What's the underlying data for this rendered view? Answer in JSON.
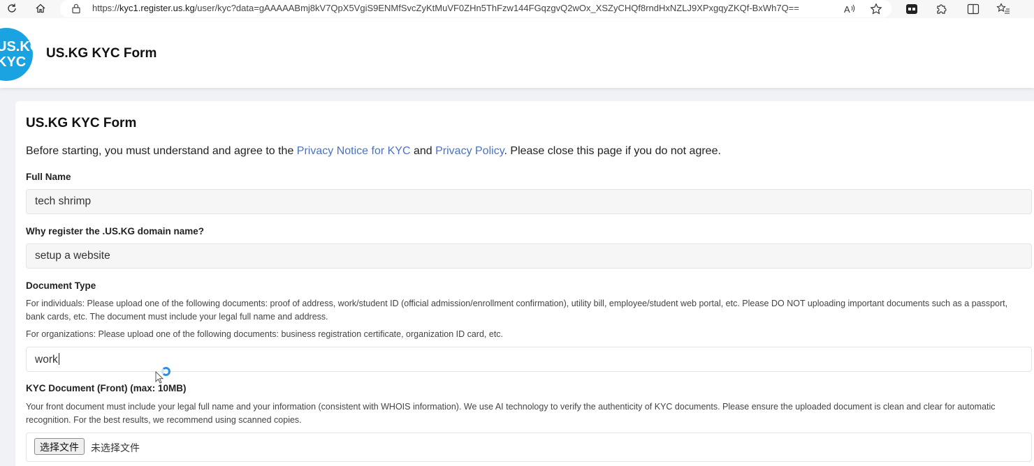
{
  "browser": {
    "url_scheme_prefix": "https://",
    "url_host": "kyc1.register.us.kg",
    "url_path": "/user/kyc?data=gAAAAABmj8kV7QpX5VgiS9ENMfSvcZyKtMuVF0ZHn5ThFzw144FGqzgvQ2wOx_XSZyCHQf8rndHxNZLJ9XPxgqyZKQf-BxWh7Q=="
  },
  "header": {
    "logo_line1": "US.KG",
    "logo_line2": "KYC",
    "title": "US.KG KYC Form"
  },
  "form": {
    "title": "US.KG KYC Form",
    "intro_before": "Before starting, you must understand and agree to the ",
    "link_kyc_notice": "Privacy Notice for KYC",
    "intro_and": " and ",
    "link_privacy_policy": "Privacy Policy",
    "intro_after": ". Please close this page if you do not agree.",
    "full_name_label": "Full Name",
    "full_name_value": "tech shrimp",
    "reason_label": "Why register the .US.KG domain name?",
    "reason_value": "setup a website",
    "doc_type_label": "Document Type",
    "doc_type_help_individuals": "For individuals: Please upload one of the following documents: proof of address, work/student ID (official admission/enrollment confirmation), utility bill, employee/student web portal, etc. Please DO NOT uploading important documents such as a passport, bank cards, etc. The document must include your legal full name and address.",
    "doc_type_help_orgs": "For organizations: Please upload one of the following documents: business registration certificate, organization ID card, etc.",
    "doc_type_value": "work",
    "kyc_front_label": "KYC Document (Front) (max: 10MB)",
    "kyc_front_help": "Your front document must include your legal full name and your information (consistent with WHOIS information). We use AI technology to verify the authenticity of KYC documents. Please ensure the uploaded document is clean and clear for automatic recognition. For the best results, we recommend using scanned copies.",
    "file_button_label": "选择文件",
    "file_status": "未选择文件"
  },
  "colors": {
    "logo": "#1aa3e0",
    "link": "#4a72c4"
  },
  "icons": [
    "refresh-icon",
    "home-icon",
    "lock-icon",
    "read-aloud-icon",
    "favorite-star-icon",
    "extension-icon",
    "puzzle-icon",
    "split-screen-icon",
    "favorites-list-icon",
    "spinner-icon",
    "mouse-cursor-icon"
  ]
}
